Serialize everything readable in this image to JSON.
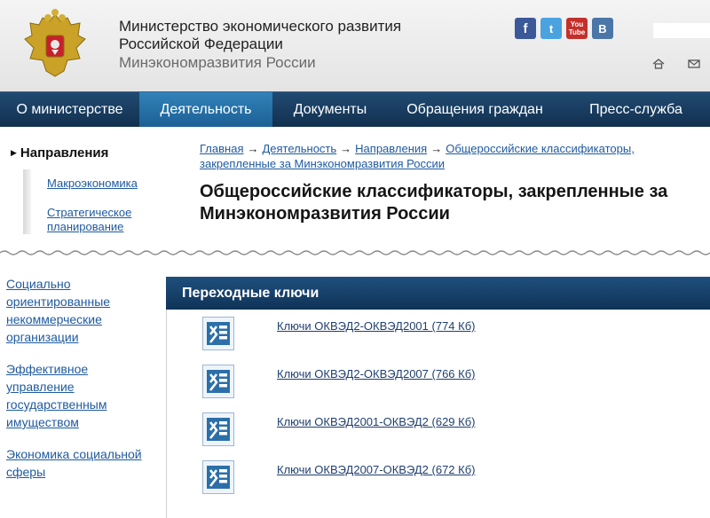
{
  "header": {
    "org_name_line1": "Министерство экономического развития",
    "org_name_line2": "Российской Федерации",
    "org_short": "Минэкономразвития России",
    "social": [
      {
        "name": "facebook",
        "glyph": "f"
      },
      {
        "name": "twitter",
        "glyph": "t"
      },
      {
        "name": "youtube",
        "glyph": "You\nTube"
      },
      {
        "name": "vkontakte",
        "glyph": "B"
      }
    ],
    "icons": [
      "home-icon",
      "mail-icon"
    ]
  },
  "nav": {
    "items": [
      {
        "label": "О министерстве",
        "active": false
      },
      {
        "label": "Деятельность",
        "active": true
      },
      {
        "label": "Документы",
        "active": false
      },
      {
        "label": "Обращения граждан",
        "active": false
      },
      {
        "label": "Пресс-служба",
        "active": false
      }
    ]
  },
  "directions": {
    "title": "Направления",
    "links": [
      {
        "line1": "Макроэкономика",
        "line2": ""
      },
      {
        "line1": "Стратегическое",
        "line2": "планирование"
      }
    ]
  },
  "breadcrumb": {
    "items": [
      "Главная",
      "Деятельность",
      "Направления",
      "Общероссийские классификаторы,",
      "закрепленные за Минэкономразвития России"
    ],
    "separator": "→"
  },
  "page": {
    "title_line1": "Общероссийские классификаторы, закрепленные за",
    "title_line2": "Минэкономразвития России"
  },
  "sidebar": {
    "links": [
      [
        "Социально",
        "ориентированные",
        "некоммерческие",
        "организации"
      ],
      [
        "Эффективное",
        "управление",
        "государственным",
        "имуществом"
      ],
      [
        "Экономика социальной",
        "сферы"
      ]
    ]
  },
  "panel": {
    "title": "Переходные ключи",
    "files": [
      {
        "label": "Ключи ОКВЭД2-ОКВЭД2001 (774 Кб)"
      },
      {
        "label": "Ключи ОКВЭД2-ОКВЭД2007 (766 Кб)"
      },
      {
        "label": "Ключи ОКВЭД2001-ОКВЭД2 (629 Кб)"
      },
      {
        "label": "Ключи ОКВЭД2007-ОКВЭД2 (672 Кб)"
      }
    ]
  },
  "colors": {
    "nav_bg": "#163a5f",
    "nav_active": "#2a78b0",
    "link": "#1f5aa0",
    "panel_header": "#174470",
    "icon_blue": "#2c6fa8"
  }
}
